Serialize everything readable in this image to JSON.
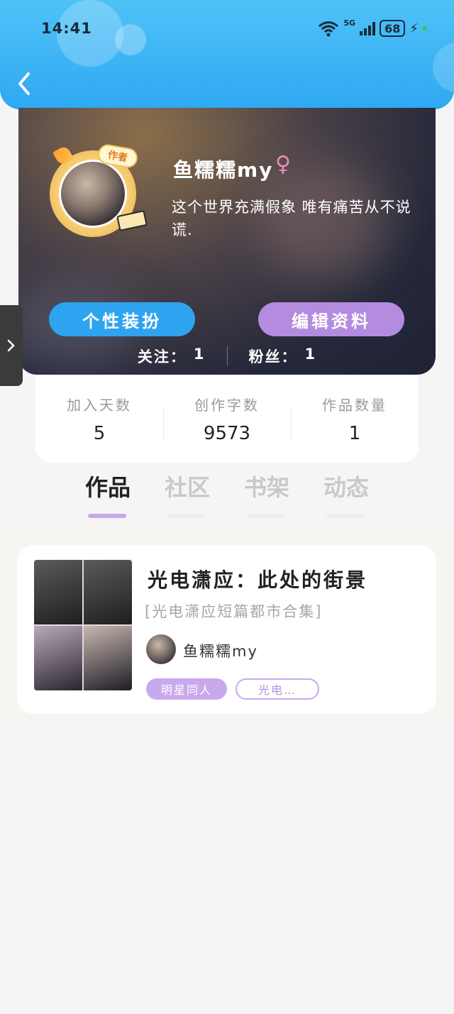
{
  "status_bar": {
    "time": "14:41",
    "network_label": "5G",
    "battery_level": "68"
  },
  "profile": {
    "badge": "作者",
    "username": "鱼糯糯my",
    "gender_symbol": "♀",
    "bio": "这个世界充满假象 唯有痛苦从不说谎.",
    "dress_button": "个性装扮",
    "edit_button": "编辑资料",
    "following_label": "关注：",
    "following_count": "1",
    "followers_label": "粉丝：",
    "followers_count": "1"
  },
  "stats": [
    {
      "label": "加入天数",
      "value": "5"
    },
    {
      "label": "创作字数",
      "value": "9573"
    },
    {
      "label": "作品数量",
      "value": "1"
    }
  ],
  "tabs": [
    {
      "label": "作品",
      "active": true
    },
    {
      "label": "社区",
      "active": false
    },
    {
      "label": "书架",
      "active": false
    },
    {
      "label": "动态",
      "active": false
    }
  ],
  "works": [
    {
      "title": "光电潇应：此处的街景",
      "subtitle": "[光电潇应短篇都市合集]",
      "author": "鱼糯糯my",
      "tags": [
        "明星同人",
        "光电…"
      ]
    }
  ],
  "colors": {
    "header_blue": "#2ea8f2",
    "accent_purple": "#b38ce0",
    "dress_button_blue": "#2ea4f0"
  }
}
